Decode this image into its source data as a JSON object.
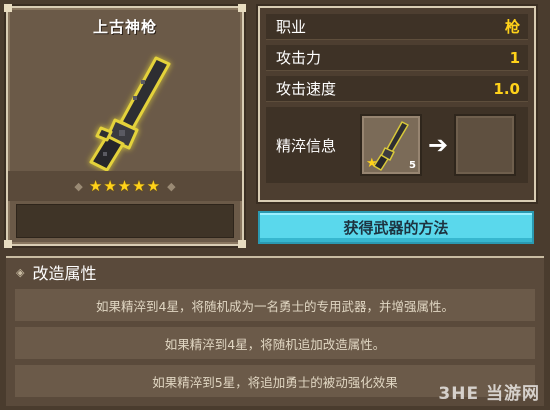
{
  "weapon": {
    "name": "上古神枪",
    "stars": "★★★★★",
    "star_count": 5,
    "icon": "revolver-icon"
  },
  "stats": [
    {
      "label": "职业",
      "value": "枪"
    },
    {
      "label": "攻击力",
      "value": "1"
    },
    {
      "label": "攻击速度",
      "value": "1.0"
    }
  ],
  "refine": {
    "label": "精淬信息",
    "material_count": "5",
    "material_star": "★",
    "arrow_icon": "arrow-right-icon"
  },
  "acquire_button": "获得武器的方法",
  "mod": {
    "title": "改造属性",
    "rows": [
      "如果精淬到4星，将随机成为一名勇士的专用武器，并增强属性。",
      "如果精淬到4星，将随机追加改造属性。",
      "如果精淬到5星，将追加勇士的被动强化效果"
    ]
  },
  "watermark": "3HE 当游网",
  "colors": {
    "accent_button": "#5ad8ec",
    "star_gold": "#ffd21a",
    "panel_bg": "#4d3e30",
    "frame_light": "#d9cdb4"
  }
}
